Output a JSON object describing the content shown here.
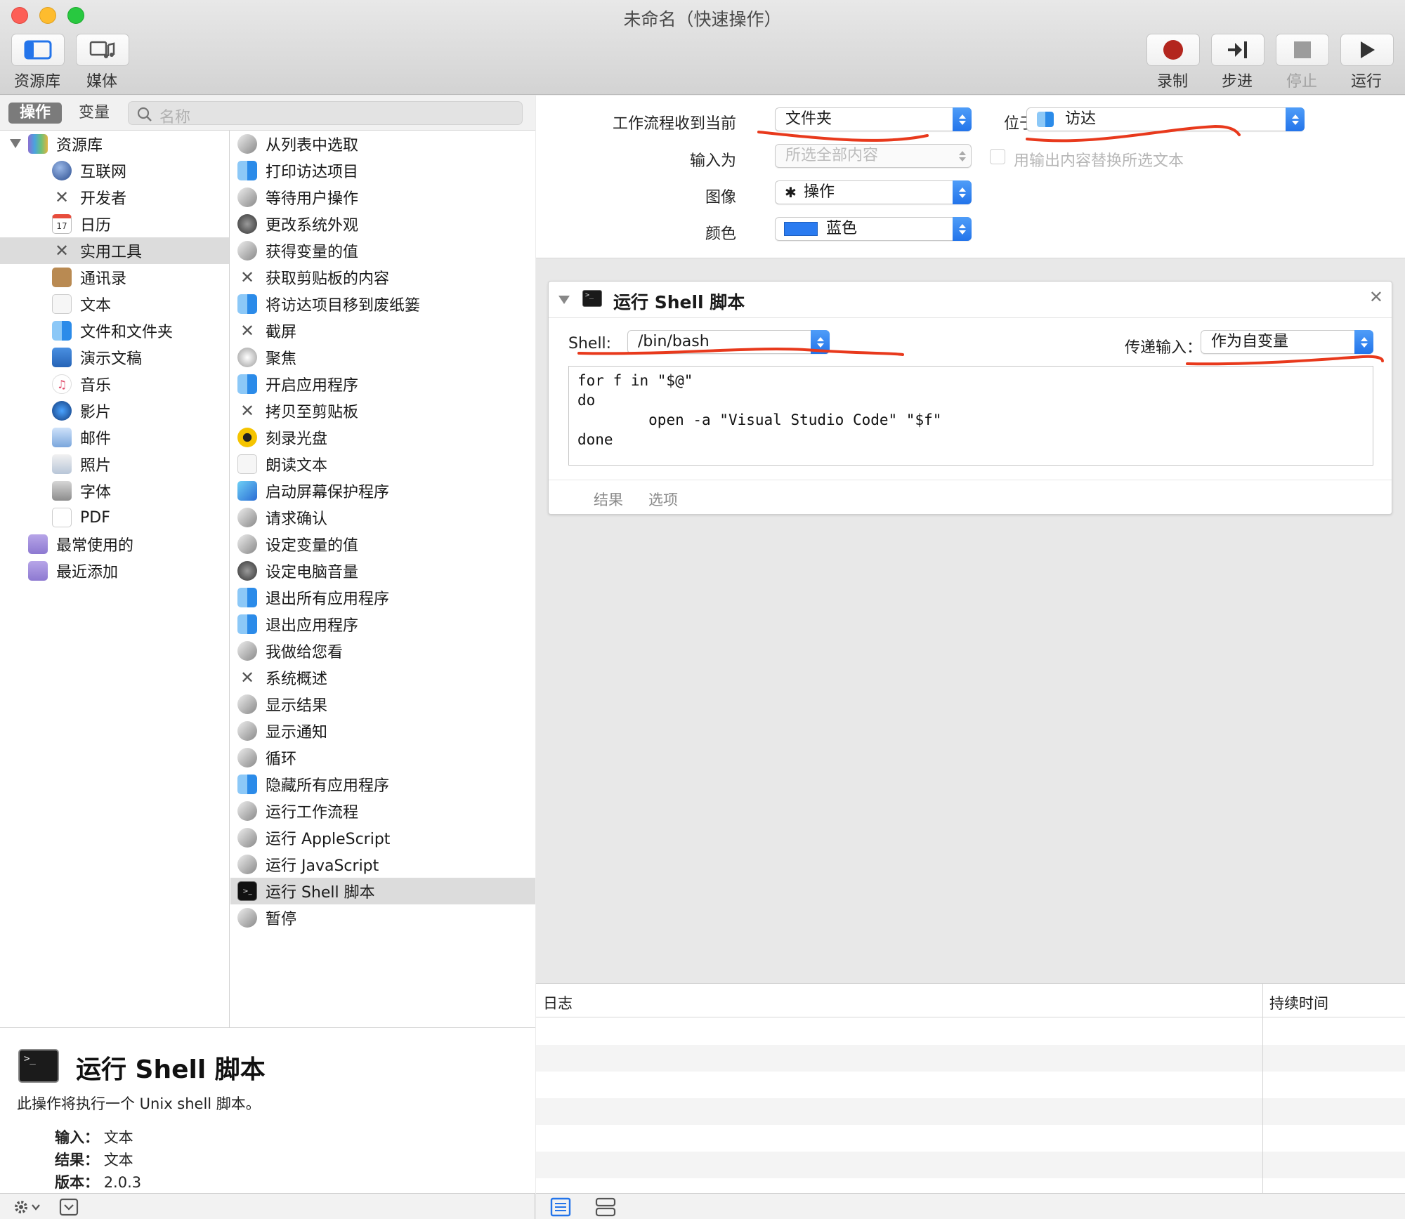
{
  "window": {
    "title": "未命名（快速操作）"
  },
  "toolbar": {
    "library_label": "资源库",
    "media_label": "媒体",
    "record_label": "录制",
    "step_label": "步进",
    "stop_label": "停止",
    "run_label": "运行"
  },
  "library_panel": {
    "tab_actions": "操作",
    "tab_variables": "变量",
    "search_placeholder": "名称",
    "root_label": "资源库",
    "categories": [
      {
        "label": "互联网",
        "icon": "globe-icon"
      },
      {
        "label": "开发者",
        "icon": "tools-icon"
      },
      {
        "label": "日历",
        "icon": "calendar-icon"
      },
      {
        "label": "实用工具",
        "icon": "tools-icon",
        "selected": true
      },
      {
        "label": "通讯录",
        "icon": "contacts-icon"
      },
      {
        "label": "文本",
        "icon": "text-icon"
      },
      {
        "label": "文件和文件夹",
        "icon": "finder-icon"
      },
      {
        "label": "演示文稿",
        "icon": "keynote-icon"
      },
      {
        "label": "音乐",
        "icon": "music-icon"
      },
      {
        "label": "影片",
        "icon": "quicktime-icon"
      },
      {
        "label": "邮件",
        "icon": "mail-icon"
      },
      {
        "label": "照片",
        "icon": "photos-icon"
      },
      {
        "label": "字体",
        "icon": "font-icon"
      },
      {
        "label": "PDF",
        "icon": "pdf-icon"
      }
    ],
    "smart_groups": [
      {
        "label": "最常使用的",
        "icon": "smart-folder-icon"
      },
      {
        "label": "最近添加",
        "icon": "smart-folder-icon"
      }
    ],
    "actions": [
      {
        "label": "从列表中选取",
        "icon": "automator-icon"
      },
      {
        "label": "打印访达项目",
        "icon": "finder-icon"
      },
      {
        "label": "等待用户操作",
        "icon": "automator-icon"
      },
      {
        "label": "更改系统外观",
        "icon": "system-prefs-icon"
      },
      {
        "label": "获得变量的值",
        "icon": "automator-icon"
      },
      {
        "label": "获取剪贴板的内容",
        "icon": "tools-icon"
      },
      {
        "label": "将访达项目移到废纸篓",
        "icon": "finder-icon"
      },
      {
        "label": "截屏",
        "icon": "tools-icon"
      },
      {
        "label": "聚焦",
        "icon": "spotlight-icon"
      },
      {
        "label": "开启应用程序",
        "icon": "finder-icon"
      },
      {
        "label": "拷贝至剪贴板",
        "icon": "tools-icon"
      },
      {
        "label": "刻录光盘",
        "icon": "burn-icon"
      },
      {
        "label": "朗读文本",
        "icon": "text-icon"
      },
      {
        "label": "启动屏幕保护程序",
        "icon": "screensaver-icon"
      },
      {
        "label": "请求确认",
        "icon": "automator-icon"
      },
      {
        "label": "设定变量的值",
        "icon": "automator-icon"
      },
      {
        "label": "设定电脑音量",
        "icon": "system-prefs-icon"
      },
      {
        "label": "退出所有应用程序",
        "icon": "finder-icon"
      },
      {
        "label": "退出应用程序",
        "icon": "finder-icon"
      },
      {
        "label": "我做给您看",
        "icon": "automator-icon"
      },
      {
        "label": "系统概述",
        "icon": "tools-icon"
      },
      {
        "label": "显示结果",
        "icon": "automator-icon"
      },
      {
        "label": "显示通知",
        "icon": "automator-icon"
      },
      {
        "label": "循环",
        "icon": "automator-icon"
      },
      {
        "label": "隐藏所有应用程序",
        "icon": "finder-icon"
      },
      {
        "label": "运行工作流程",
        "icon": "automator-icon"
      },
      {
        "label": "运行 AppleScript",
        "icon": "automator-icon"
      },
      {
        "label": "运行 JavaScript",
        "icon": "automator-icon"
      },
      {
        "label": "运行 Shell 脚本",
        "icon": "terminal-icon",
        "selected": true
      },
      {
        "label": "暂停",
        "icon": "automator-icon"
      }
    ]
  },
  "description": {
    "title": "运行 Shell 脚本",
    "summary": "此操作将执行一个 Unix shell 脚本。",
    "input_label": "输入：",
    "input_value": "文本",
    "result_label": "结果：",
    "result_value": "文本",
    "version_label": "版本：",
    "version_value": "2.0.3"
  },
  "workflow_header": {
    "receives_label": "工作流程收到当前",
    "receives_value": "文件夹",
    "in_label": "位于",
    "in_value": "访达",
    "input_is_label": "输入为",
    "input_is_value": "所选全部内容",
    "replace_label": "用输出内容替换所选文本",
    "image_label": "图像",
    "image_value": "操作",
    "color_label": "颜色",
    "color_value": "蓝色",
    "color_swatch": "#2a7bf0"
  },
  "action_card": {
    "title": "运行 Shell 脚本",
    "shell_label": "Shell:",
    "shell_value": "/bin/bash",
    "pass_input_label": "传递输入：",
    "pass_input_value": "作为自变量",
    "script": "for f in \"$@\"\ndo\n\topen -a \"Visual Studio Code\" \"$f\"\ndone",
    "tab_results": "结果",
    "tab_options": "选项"
  },
  "log": {
    "col_log": "日志",
    "col_duration": "持续时间"
  },
  "colors": {
    "accent_blue": "#2374ea",
    "annotation_red": "#e8391c",
    "record_red": "#b3261e"
  }
}
